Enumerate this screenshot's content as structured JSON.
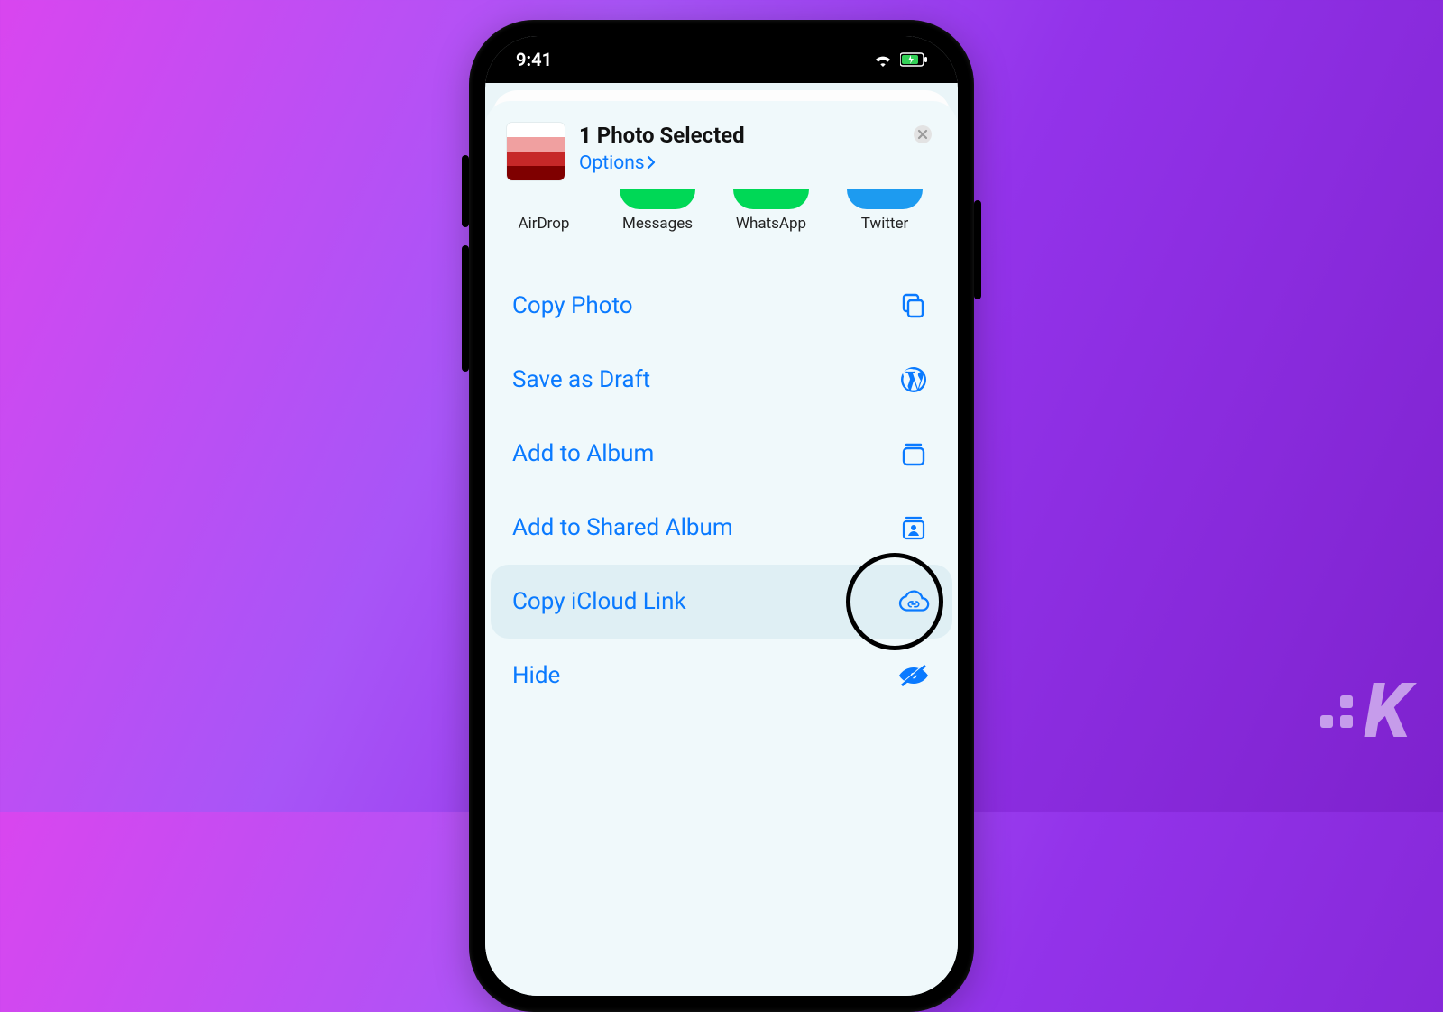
{
  "status": {
    "time": "9:41"
  },
  "sheet": {
    "title": "1 Photo Selected",
    "options_label": "Options"
  },
  "apps": [
    {
      "label": "AirDrop",
      "color": "airdrop"
    },
    {
      "label": "Messages",
      "color": "green"
    },
    {
      "label": "WhatsApp",
      "color": "green"
    },
    {
      "label": "Twitter",
      "color": "blue"
    }
  ],
  "actions": [
    {
      "label": "Copy Photo",
      "icon": "copy-icon"
    },
    {
      "label": "Save as Draft",
      "icon": "wordpress-icon"
    },
    {
      "label": "Add to Album",
      "icon": "album-icon"
    },
    {
      "label": "Add to Shared Album",
      "icon": "shared-album-icon"
    },
    {
      "label": "Copy iCloud Link",
      "icon": "cloud-link-icon",
      "highlighted": true,
      "circled": true
    },
    {
      "label": "Hide",
      "icon": "eye-slash-icon"
    }
  ],
  "watermark": "K"
}
